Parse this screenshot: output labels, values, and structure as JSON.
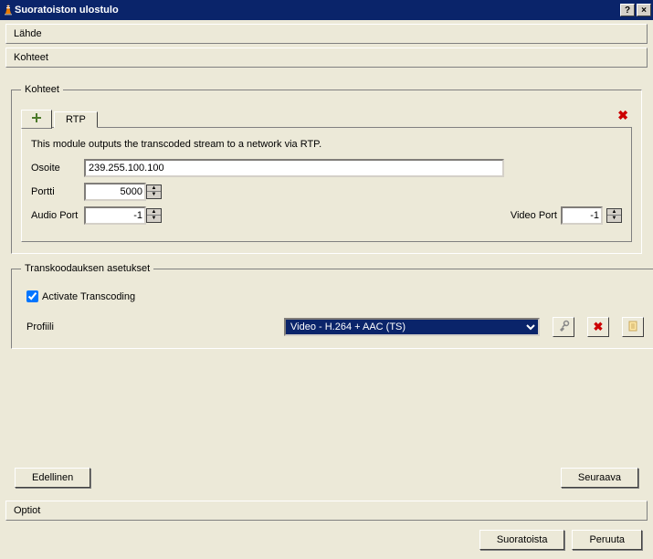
{
  "window": {
    "title": "Suoratoiston ulostulo"
  },
  "panels": {
    "source": "Lähde",
    "destinations": "Kohteet",
    "options": "Optiot"
  },
  "groups": {
    "destinations": "Kohteet",
    "transcoding": "Transkoodauksen asetukset"
  },
  "tabs": {
    "plus": "+",
    "rtp": "RTP"
  },
  "rtp": {
    "description": "This module outputs the transcoded stream to a network via RTP.",
    "address_label": "Osoite",
    "address_value": "239.255.100.100",
    "port_label": "Portti",
    "port_value": "5000",
    "audio_port_label": "Audio Port",
    "audio_port_value": "-1",
    "video_port_label": "Video Port",
    "video_port_value": "-1"
  },
  "transcoding": {
    "activate_label": "Activate Transcoding",
    "activate_checked": true,
    "profile_label": "Profiili",
    "profile_value": "Video - H.264 + AAC (TS)"
  },
  "buttons": {
    "previous": "Edellinen",
    "next": "Seuraava",
    "stream": "Suoratoista",
    "cancel": "Peruuta"
  },
  "icons": {
    "help": "?",
    "close": "×",
    "tab_close": "✖",
    "tools": "⚒",
    "delete": "✖",
    "copy": "📄",
    "spin_up": "▲",
    "spin_down": "▼"
  }
}
